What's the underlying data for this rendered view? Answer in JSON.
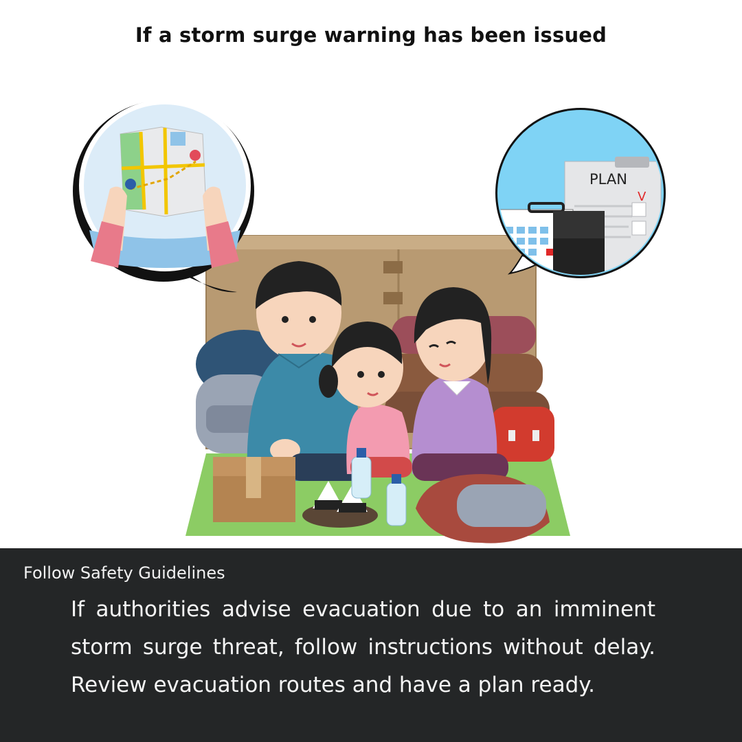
{
  "header": {
    "title": "If a storm surge warning has been issued"
  },
  "illustration": {
    "scene": "family-in-evacuation-shelter-icon",
    "left_bubble": "hands-holding-map-icon",
    "right_bubble": {
      "icon": "plan-clipboard-calendar-briefcase-icon",
      "label": "PLAN",
      "mark": "V"
    },
    "colors": {
      "sky": "#7fd3f5",
      "map_bg": "#dcecf8",
      "cardboard": "#b89a72",
      "mat": "#8ccc64",
      "father_shirt": "#3c8aa8",
      "mother_shirt": "#b58ed0",
      "girl_shirt": "#f39bb0"
    }
  },
  "panel": {
    "heading": "Follow Safety Guidelines",
    "body": "If authorities advise evacuation due to an imminent storm surge threat, follow instructions without delay. Review evacuation routes and have a plan ready.",
    "background": "#242627"
  }
}
